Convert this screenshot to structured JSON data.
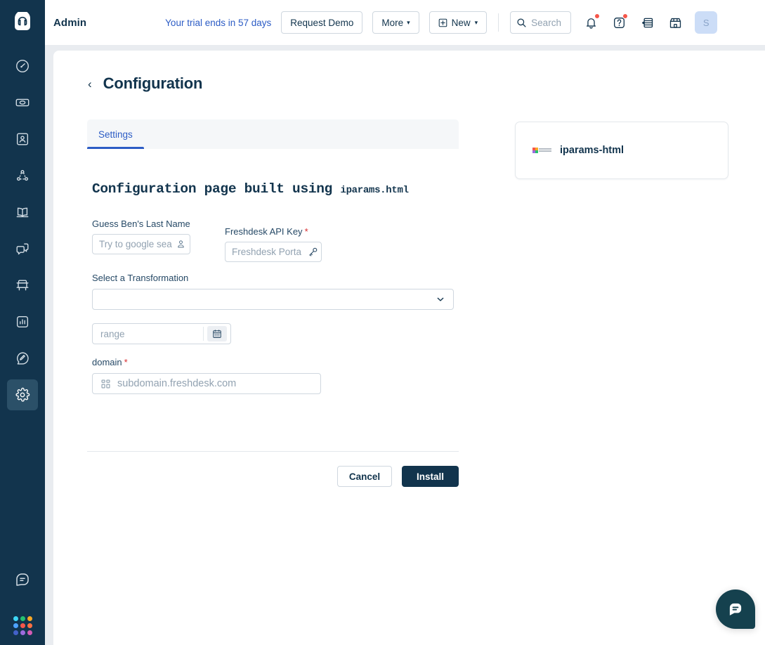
{
  "topbar": {
    "logo_icon": "headset-logo-icon",
    "brand_title": "Admin",
    "trial_text": "Your trial ends in 57 days",
    "request_demo_label": "Request Demo",
    "more_label": "More",
    "more_caret": "⌄",
    "new_label": "New",
    "new_caret": "⌄",
    "new_plus_icon": "plus-square-icon",
    "search_icon": "search-icon",
    "search_placeholder": "Search",
    "bell_icon": "notification-bell-icon",
    "help_icon": "help-question-icon",
    "academy_icon": "academy-icon",
    "marketplace_icon": "marketplace-storefront-icon",
    "avatar_initial": "S"
  },
  "sidebar": {
    "items": [
      {
        "name": "sidebar-item-dashboard",
        "icon": "gauge-icon",
        "active": false
      },
      {
        "name": "sidebar-item-tickets",
        "icon": "ticket-icon",
        "active": false
      },
      {
        "name": "sidebar-item-contacts",
        "icon": "contact-card-icon",
        "active": false
      },
      {
        "name": "sidebar-item-social",
        "icon": "network-nodes-icon",
        "active": false
      },
      {
        "name": "sidebar-item-solutions",
        "icon": "open-book-icon",
        "active": false
      },
      {
        "name": "sidebar-item-forums",
        "icon": "chat-bubbles-icon",
        "active": false
      },
      {
        "name": "sidebar-item-academy",
        "icon": "academy-desk-icon",
        "active": false
      },
      {
        "name": "sidebar-item-analytics",
        "icon": "bar-chart-icon",
        "active": false
      },
      {
        "name": "sidebar-item-feedback",
        "icon": "feedback-pencil-icon",
        "active": false
      },
      {
        "name": "sidebar-item-admin",
        "icon": "gear-icon",
        "active": true
      }
    ],
    "bottom": {
      "messaging_icon": "messaging-icon",
      "app_switcher_icon": "app-switcher-grid-icon",
      "app_switcher_colors": [
        "#3dd6f5",
        "#25c16f",
        "#f9a825",
        "#4da3ff",
        "#f5564a",
        "#ff7043",
        "#4361c9",
        "#9c6ade",
        "#d45bb5"
      ]
    }
  },
  "page": {
    "back_icon": "chevron-left-icon",
    "title": "Configuration"
  },
  "tabs": [
    {
      "label": "Settings",
      "active": true
    }
  ],
  "form": {
    "heading_main": "Configuration page built using ",
    "heading_mono": "iparams.html",
    "fields": {
      "guess_name": {
        "label": "Guess Ben's Last Name",
        "placeholder": "Try to google sea",
        "icon": "person-icon",
        "required": false
      },
      "api_key": {
        "label": "Freshdesk API Key",
        "required_mark": "*",
        "placeholder": "Freshdesk Porta",
        "icon": "key-icon",
        "required": true
      },
      "transformation": {
        "label": "Select a Transformation",
        "value": "",
        "chevron_icon": "chevron-down-icon"
      },
      "range": {
        "placeholder": "range",
        "calendar_icon": "calendar-icon"
      },
      "domain": {
        "label": "domain",
        "required_mark": "*",
        "placeholder": "subdomain.freshdesk.com",
        "icon": "grid-squares-icon",
        "required": true
      }
    },
    "cancel_label": "Cancel",
    "install_label": "Install"
  },
  "app_card": {
    "logo_icon": "freshworks-app-logo-icon",
    "name": "iparams-html"
  },
  "chat": {
    "icon": "chat-message-icon"
  },
  "colors": {
    "rail_bg": "#12344d",
    "accent_blue": "#2c5cc5",
    "page_bg": "#e9ecf0",
    "install_btn": "#12344d",
    "required_red": "#d72d30",
    "badge_red": "#f5564a",
    "chat_bg": "#15414e",
    "avatar_bg": "#ccddf7"
  }
}
